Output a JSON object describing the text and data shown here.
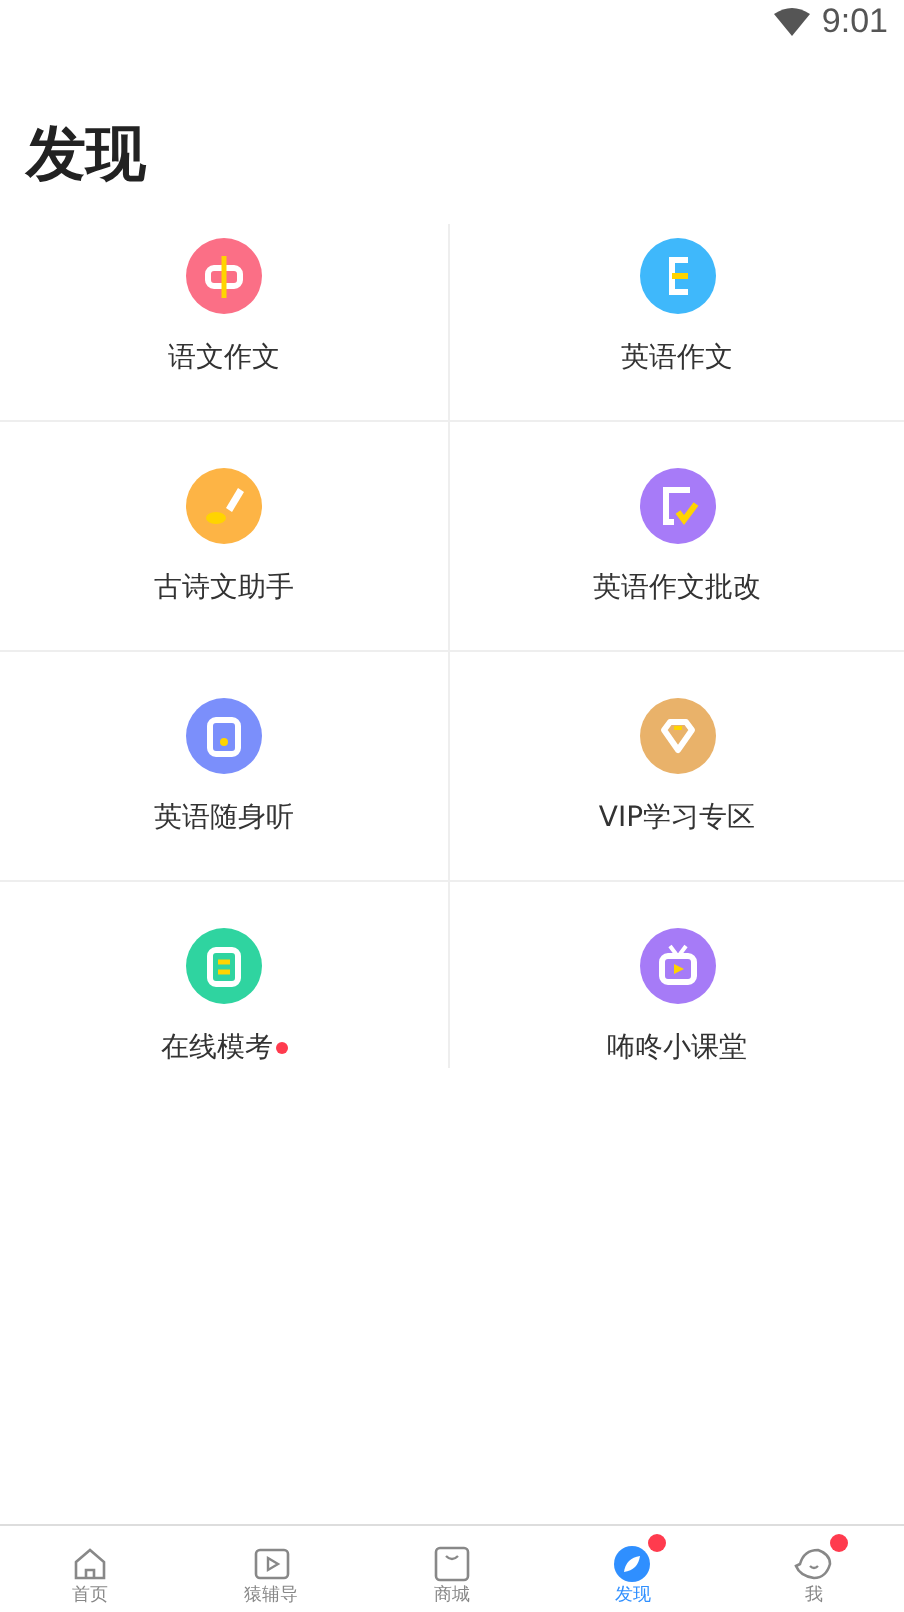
{
  "status_bar": {
    "time": "9:01"
  },
  "title": "发现",
  "items": [
    {
      "label": "语文作文",
      "kind": "zhong",
      "color": "#fb6f86",
      "badge": false
    },
    {
      "label": "英语作文",
      "kind": "e",
      "color": "#3fb8fb",
      "badge": false
    },
    {
      "label": "古诗文助手",
      "kind": "brush",
      "color": "#fdb445",
      "badge": false
    },
    {
      "label": "英语作文批改",
      "kind": "check",
      "color": "#a77bf8",
      "badge": false
    },
    {
      "label": "英语随身听",
      "kind": "player",
      "color": "#7b8ffb",
      "badge": false
    },
    {
      "label": "VIP学习专区",
      "kind": "diamond",
      "color": "#e9b26a",
      "badge": false
    },
    {
      "label": "在线模考",
      "kind": "paper",
      "color": "#2fd4a0",
      "badge": true
    },
    {
      "label": "咘咚小课堂",
      "kind": "tv",
      "color": "#a67bf7",
      "badge": false
    }
  ],
  "tabs": [
    {
      "label": "首页",
      "kind": "home",
      "selected": false,
      "badge": false
    },
    {
      "label": "猿辅导",
      "kind": "play",
      "selected": false,
      "badge": false
    },
    {
      "label": "商城",
      "kind": "bag",
      "selected": false,
      "badge": false
    },
    {
      "label": "发现",
      "kind": "compass",
      "selected": true,
      "badge": true
    },
    {
      "label": "我",
      "kind": "face",
      "selected": false,
      "badge": true
    }
  ]
}
